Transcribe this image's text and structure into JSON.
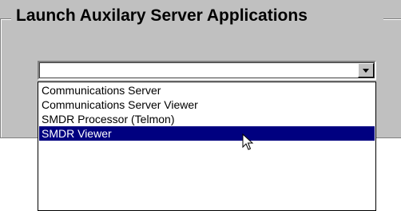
{
  "group": {
    "title": "Launch Auxilary Server Applications"
  },
  "combo": {
    "selected_value": "",
    "button_icon": "chevron-down-icon"
  },
  "dropdown": {
    "options": [
      "Communications Server",
      "Communications Server Viewer",
      "SMDR Processor (Telmon)",
      "SMDR Viewer"
    ],
    "highlighted_index": 3
  },
  "colors": {
    "panel": "#c0c0c0",
    "highlight": "#000080",
    "highlight_text": "#ffffff"
  }
}
